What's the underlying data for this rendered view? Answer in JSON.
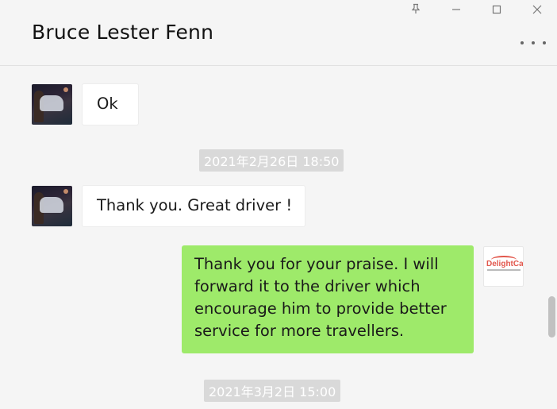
{
  "header": {
    "title": "Bruce Lester Fenn"
  },
  "window_controls": {
    "pin_icon": "pin-icon",
    "minimize_icon": "minimize-icon",
    "maximize_icon": "maximize-icon",
    "close_icon": "close-icon"
  },
  "messages": [
    {
      "type": "incoming",
      "text": "Ok"
    },
    {
      "type": "timestamp",
      "text": "2021年2月26日 18:50"
    },
    {
      "type": "incoming",
      "text": "Thank you. Great driver !"
    },
    {
      "type": "outgoing",
      "lines": [
        "Thank you for your praise. I will",
        "forward it to the driver which",
        "encourage him to provide better",
        "service for more travellers."
      ]
    },
    {
      "type": "timestamp",
      "text": "2021年3月2日 15:00"
    }
  ],
  "logo": {
    "text": "DelightCar"
  },
  "colors": {
    "outgoing_bubble": "#9eea6a",
    "incoming_bubble": "#ffffff",
    "background": "#f5f5f5",
    "timestamp_bg": "#d9d9d9"
  }
}
